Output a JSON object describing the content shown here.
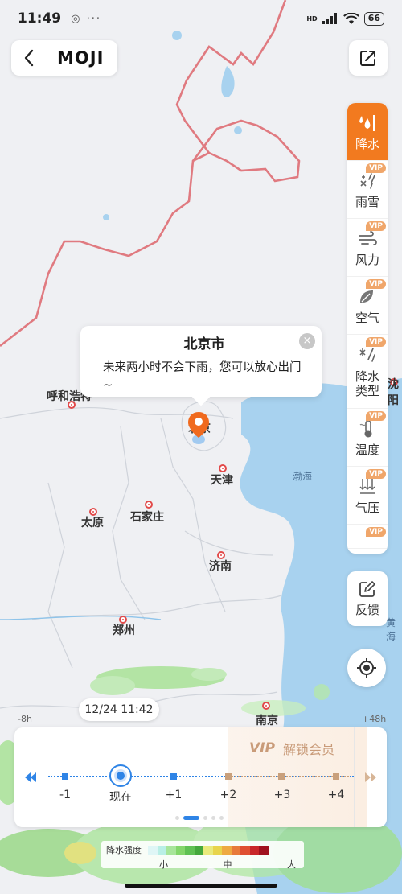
{
  "status_bar": {
    "time": "11:49",
    "extra": "◎ ···",
    "hd": "HD",
    "battery": "66"
  },
  "header": {
    "brand": "MOJI"
  },
  "popup": {
    "title": "北京市",
    "message": "未来两小时不会下雨，您可以放心出门~",
    "close": "×"
  },
  "layers": [
    {
      "label": "降水",
      "vip": false,
      "active": true,
      "icon": "rain-drops-icon"
    },
    {
      "label": "雨雪",
      "vip": true,
      "active": false,
      "icon": "rain-snow-icon"
    },
    {
      "label": "风力",
      "vip": true,
      "active": false,
      "icon": "wind-icon"
    },
    {
      "label": "空气",
      "vip": true,
      "active": false,
      "icon": "leaf-icon"
    },
    {
      "label": "降水类型",
      "vip": true,
      "active": false,
      "icon": "precip-type-icon"
    },
    {
      "label": "温度",
      "vip": true,
      "active": false,
      "icon": "thermometer-icon"
    },
    {
      "label": "气压",
      "vip": true,
      "active": false,
      "icon": "pressure-icon"
    },
    {
      "label": "",
      "vip": true,
      "active": false,
      "icon": "more-icon"
    }
  ],
  "vip_badge": "VIP",
  "feedback": {
    "label": "反馈"
  },
  "map": {
    "cities": [
      {
        "name": "呼和浩特"
      },
      {
        "name": "北京"
      },
      {
        "name": "天津"
      },
      {
        "name": "太原"
      },
      {
        "name": "石家庄"
      },
      {
        "name": "济南"
      },
      {
        "name": "郑州"
      },
      {
        "name": "南京"
      },
      {
        "name": "沈阳"
      }
    ],
    "seas": [
      "渤海",
      "黄海"
    ]
  },
  "timeline": {
    "timestamp": "12/24 11:42",
    "left_offset": "-8h",
    "right_offset": "+48h",
    "unlock_vip": "VIP",
    "unlock_text": "解锁会员",
    "labels": [
      "-1",
      "现在",
      "+1",
      "+2",
      "+3",
      "+4"
    ]
  },
  "legend": {
    "title": "降水强度",
    "low": "小",
    "mid": "中",
    "high": "大",
    "colors": [
      "#dff6f6",
      "#b9efe6",
      "#a7e59a",
      "#83d66a",
      "#5fc153",
      "#44a83c",
      "#e9ea7c",
      "#e8d44c",
      "#eeaa42",
      "#e77b3b",
      "#df4f32",
      "#c8262a",
      "#a0111f"
    ]
  },
  "colors": {
    "accent": "#f27a1f",
    "timeline_blue": "#2f84e6",
    "vip_gold": "#c9a07c",
    "border_red": "#e06a6a"
  }
}
